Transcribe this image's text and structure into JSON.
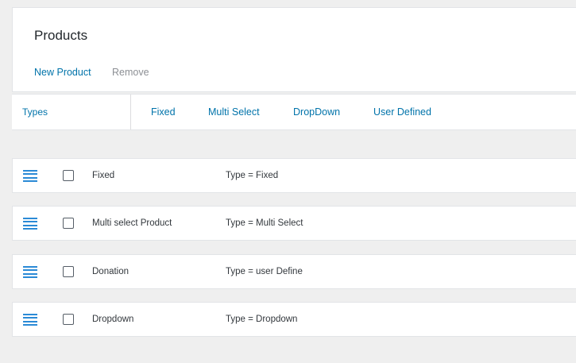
{
  "header": {
    "title": "Products",
    "actions": {
      "new_product": "New Product",
      "remove": "Remove"
    }
  },
  "types_bar": {
    "label": "Types",
    "filters": [
      "Fixed",
      "Multi Select",
      "DropDown",
      "User Defined"
    ]
  },
  "products": [
    {
      "name": "Fixed",
      "type": "Type = Fixed"
    },
    {
      "name": "Multi select Product",
      "type": "Type = Multi Select"
    },
    {
      "name": "Donation",
      "type": "Type = user Define"
    },
    {
      "name": "Dropdown",
      "type": "Type = Dropdown"
    }
  ],
  "colors": {
    "link": "#0073aa",
    "disabled": "#8c8f94",
    "drag_handle": "#2b8ad6",
    "background": "#efefef"
  },
  "icons": {
    "drag_handle": "drag-handle-icon",
    "checkbox": "checkbox"
  }
}
